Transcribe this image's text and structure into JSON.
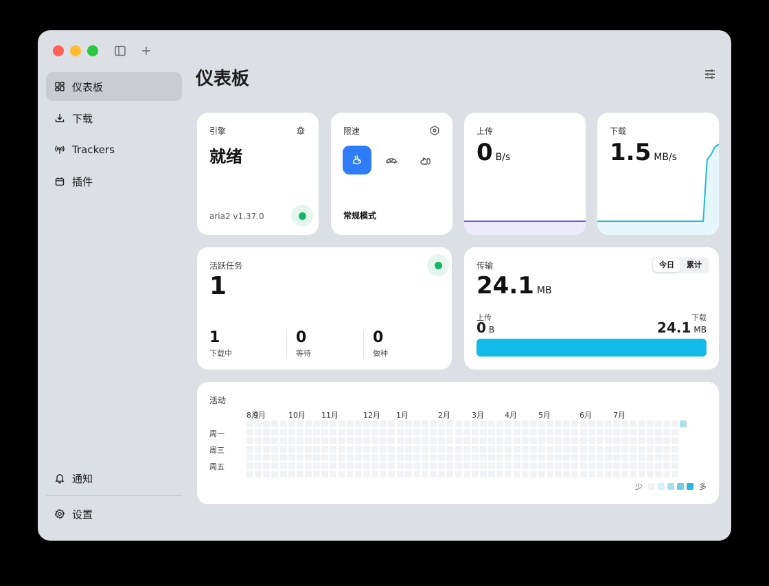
{
  "sidebar": {
    "items": [
      {
        "label": "仪表板",
        "icon": "dashboard-icon",
        "active": true
      },
      {
        "label": "下载",
        "icon": "download-icon"
      },
      {
        "label": "Trackers",
        "icon": "antenna-icon"
      },
      {
        "label": "插件",
        "icon": "plugin-icon"
      }
    ],
    "bottom": [
      {
        "label": "通知",
        "icon": "bell-icon"
      },
      {
        "label": "设置",
        "icon": "gear-icon"
      }
    ]
  },
  "page": {
    "title": "仪表板"
  },
  "engine": {
    "label": "引擎",
    "status": "就绪",
    "version": "aria2 v1.37.0"
  },
  "limit": {
    "label": "限速",
    "mode": "常规模式",
    "modes": [
      "rabbit",
      "turtle",
      "squirrel"
    ],
    "active_mode": 0
  },
  "upload": {
    "label": "上传",
    "value": "0",
    "unit": "B/s",
    "speed_history": [
      0,
      0,
      0,
      0,
      0,
      0,
      0,
      0,
      0,
      0,
      0,
      0
    ]
  },
  "download": {
    "label": "下载",
    "value": "1.5",
    "unit": "MB/s",
    "speed_history": [
      0,
      0,
      0,
      0,
      0,
      0,
      0,
      0,
      0,
      0,
      0,
      0,
      0,
      0,
      0,
      0,
      0,
      0,
      0,
      0,
      0,
      0,
      0,
      0,
      0,
      0,
      0,
      0,
      1.2,
      1.3,
      1.45,
      1.5
    ]
  },
  "active_tasks": {
    "label": "活跃任务",
    "value": "1",
    "stats": [
      {
        "value": "1",
        "label": "下载中"
      },
      {
        "value": "0",
        "label": "等待"
      },
      {
        "value": "0",
        "label": "做种"
      }
    ]
  },
  "transfer": {
    "label": "传输",
    "tabs": [
      "今日",
      "累计"
    ],
    "active_tab": 0,
    "value": "24.1",
    "unit": "MB",
    "up_label": "上传",
    "up_value": "0",
    "up_unit": "B",
    "down_label": "下载",
    "down_value": "24.1",
    "down_unit": "MB",
    "bar_color": "#13bbe8"
  },
  "activity": {
    "label": "活动",
    "months": [
      "8月",
      "9月",
      "10月",
      "11月",
      "12月",
      "1月",
      "2月",
      "3月",
      "4月",
      "5月",
      "6月",
      "7月"
    ],
    "weekdays": [
      "周一",
      "周三",
      "周五"
    ],
    "legend_less": "少",
    "legend_more": "多",
    "legend_colors": [
      "#f1f2f4",
      "#d8f1f8",
      "#a8e0f0",
      "#6ccce8",
      "#2bb5df"
    ],
    "active_color": "#a8dff2"
  },
  "colors": {
    "accent": "#2f7df6",
    "success": "#12b76a",
    "upload_line": "#6a5bd6",
    "download_line": "#22b8d9"
  }
}
